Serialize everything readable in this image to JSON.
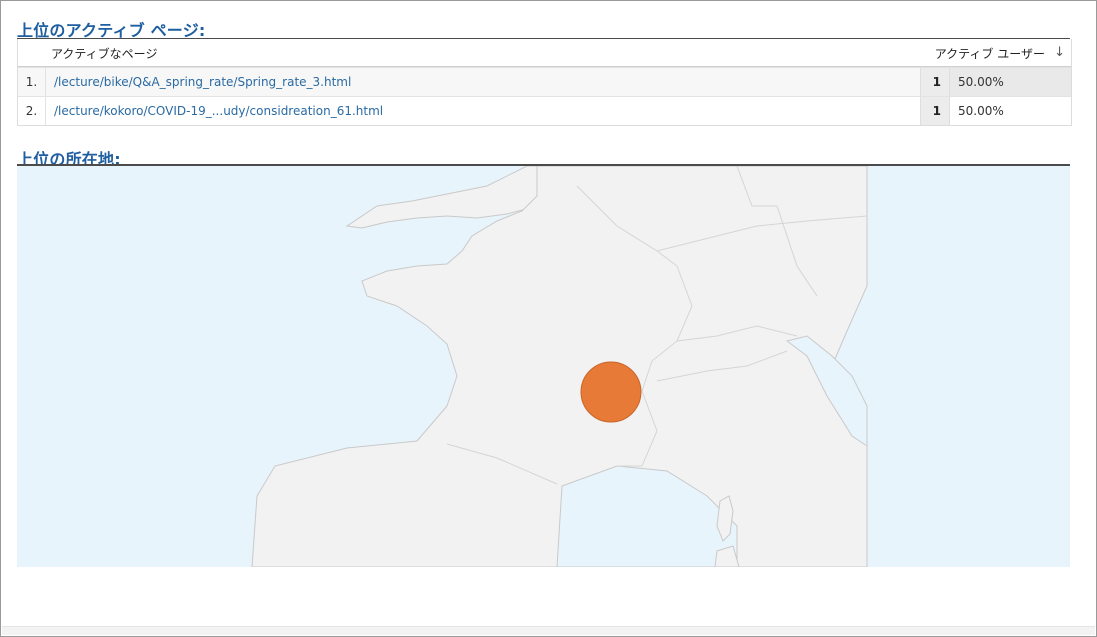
{
  "top_pages": {
    "title": "上位のアクティブ ページ:",
    "columns": {
      "page": "アクティブなページ",
      "users": "アクティブ ユーザー"
    },
    "rows": [
      {
        "index": "1.",
        "path": "/lecture/bike/Q&A_spring_rate/Spring_rate_3.html",
        "count": "1",
        "percent": "50.00%"
      },
      {
        "index": "2.",
        "path": "/lecture/kokoro/COVID-19_...udy/considreation_61.html",
        "count": "1",
        "percent": "50.00%"
      }
    ]
  },
  "locations": {
    "title": "上位の所在地:",
    "marker_color": "#e67a36",
    "sea_color": "#e8f4fb",
    "land_color": "#f2f2f2"
  },
  "icons": {
    "sort": "arrow-down-icon"
  }
}
